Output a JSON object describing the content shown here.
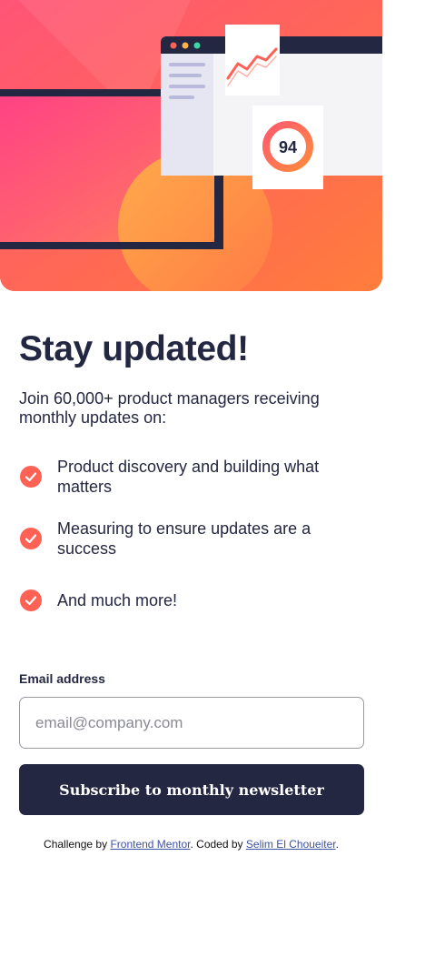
{
  "hero": {
    "score": "94",
    "icons": [
      "dashboard-illustration",
      "line-chart-icon",
      "score-ring"
    ]
  },
  "main": {
    "title": "Stay updated!",
    "intro": "Join 60,000+ product managers receiving monthly updates on:",
    "features": [
      {
        "icon": "check-icon",
        "text": "Product discovery and building what matters"
      },
      {
        "icon": "check-icon",
        "text": "Measuring to ensure updates are a success"
      },
      {
        "icon": "check-icon",
        "text": "And much more!"
      }
    ]
  },
  "form": {
    "email_label": "Email address",
    "email_placeholder": "email@company.com",
    "email_value": "",
    "submit_label": "Subscribe to monthly newsletter"
  },
  "footer": {
    "prefix": "Challenge by",
    "challenge_link": "Frontend Mentor",
    "middle": ". Coded by",
    "author_link": "Selim El Choueiter",
    "suffix": "."
  },
  "colors": {
    "accent": "#ff6155",
    "dark_navy": "#242742",
    "link": "#3e52a3",
    "white": "#ffffff"
  }
}
